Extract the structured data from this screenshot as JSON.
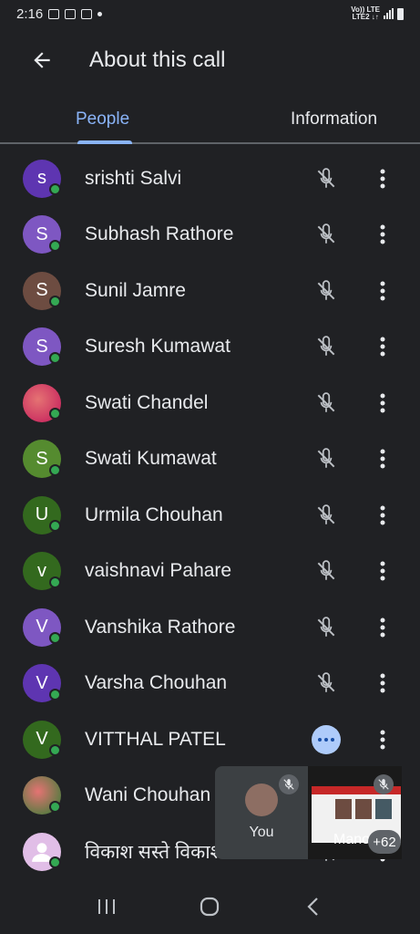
{
  "status_bar": {
    "time": "2:16",
    "network_line1": "Vo)) LTE",
    "network_line2": "LTE2 ↓↑"
  },
  "app_bar": {
    "back_icon": "arrow-back-icon",
    "title": "About this call"
  },
  "tabs": [
    {
      "label": "People",
      "active": true
    },
    {
      "label": "Information",
      "active": false
    }
  ],
  "participants": [
    {
      "initial": "s",
      "name": "srishti Salvi",
      "avatar_color": "#5e35b1",
      "status": "muted"
    },
    {
      "initial": "S",
      "name": "Subhash Rathore",
      "avatar_color": "#7e57c2",
      "status": "muted"
    },
    {
      "initial": "S",
      "name": "Sunil Jamre",
      "avatar_color": "#6d4c41",
      "status": "muted"
    },
    {
      "initial": "S",
      "name": "Suresh Kumawat",
      "avatar_color": "#7e57c2",
      "status": "muted"
    },
    {
      "initial": "",
      "name": "Swati Chandel",
      "avatar_color": "#c2185b",
      "status": "muted",
      "photo": true
    },
    {
      "initial": "S",
      "name": "Swati Kumawat",
      "avatar_color": "#558b2f",
      "status": "muted"
    },
    {
      "initial": "U",
      "name": "Urmila Chouhan",
      "avatar_color": "#33691e",
      "status": "muted"
    },
    {
      "initial": "v",
      "name": "vaishnavi Pahare",
      "avatar_color": "#33691e",
      "status": "muted"
    },
    {
      "initial": "V",
      "name": "Vanshika Rathore",
      "avatar_color": "#7e57c2",
      "status": "muted"
    },
    {
      "initial": "V",
      "name": "Varsha Chouhan",
      "avatar_color": "#5e35b1",
      "status": "muted"
    },
    {
      "initial": "V",
      "name": "VITTHAL PATEL",
      "avatar_color": "#33691e",
      "status": "talking"
    },
    {
      "initial": "",
      "name": "Wani Chouhan",
      "avatar_color": "#2e7d32",
      "status": "muted",
      "photo": true
    },
    {
      "initial": "",
      "name": "विकाश सस्ते विकाश",
      "avatar_color": "#ab47bc",
      "status": "muted",
      "person_icon": true
    }
  ],
  "pip": {
    "you_label": "You",
    "share_label": "Manoj",
    "more_count": "+62"
  },
  "colors": {
    "background": "#202124",
    "accent": "#8ab4f8",
    "online": "#34a853",
    "talking": "#aecbfa"
  }
}
